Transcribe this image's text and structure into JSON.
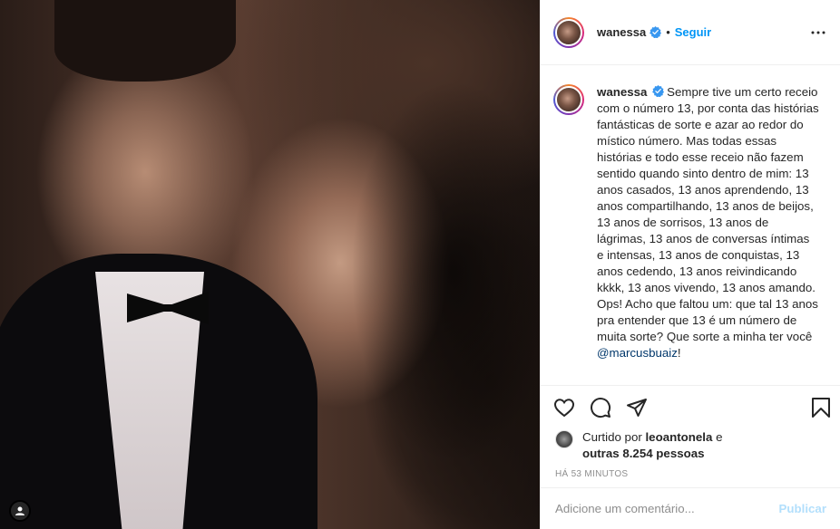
{
  "post": {
    "username": "wanessa",
    "verified": true,
    "follow_label": "Seguir",
    "separator": "•",
    "more_icon": "more-horizontal-icon"
  },
  "caption": {
    "username": "wanessa",
    "text_before_mention": "Sempre tive um certo receio com o número 13, por conta das histórias fantásticas de sorte e azar ao redor do místico número. Mas todas essas histórias e todo esse receio não fazem sentido quando sinto dentro de mim: 13 anos casados, 13 anos aprendendo, 13 anos compartilhando, 13 anos de beijos, 13 anos de sorrisos, 13 anos de lágrimas, 13 anos de conversas íntimas e intensas, 13 anos de conquistas, 13 anos cedendo, 13 anos reivindicando kkkk, 13 anos vivendo, 13 anos amando. Ops! Acho que faltou um: que tal 13 anos pra entender que 13 é um número de muita sorte? Que sorte a minha ter você",
    "mention": "@marcusbuaiz",
    "text_after_mention": "!"
  },
  "actions": {
    "icons": [
      "heart-icon",
      "comment-icon",
      "share-icon",
      "bookmark-icon"
    ]
  },
  "likes": {
    "prefix": "Curtido por",
    "user": "leoantonela",
    "connector": "e",
    "others": "outras 8.254 pessoas"
  },
  "timestamp": "HÁ 53 MINUTOS",
  "comment_box": {
    "placeholder": "Adicione um comentário...",
    "post_label": "Publicar"
  },
  "colors": {
    "accent": "#0095f6",
    "verified": "#3897f0",
    "muted": "#8e8e8e",
    "post_disabled": "#b2dffc"
  }
}
